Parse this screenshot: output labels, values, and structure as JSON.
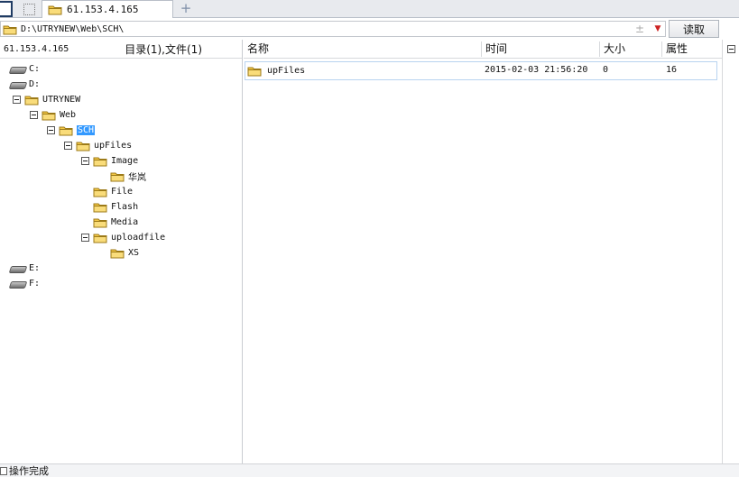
{
  "tabs": [
    {
      "label": "61.153.4.165"
    }
  ],
  "address": {
    "path": "D:\\UTRYNEW\\Web\\SCH\\",
    "up_glyph": "±",
    "drop_glyph": "▼",
    "read_label": "读取"
  },
  "left": {
    "host": "61.153.4.165",
    "count": "目录(1),文件(1)",
    "tree": [
      {
        "label": "C:",
        "type": "drive",
        "level": 0,
        "toggle": false
      },
      {
        "label": "D:",
        "type": "drive",
        "level": 0,
        "toggle": false
      },
      {
        "label": "UTRYNEW",
        "type": "folder",
        "level": 1,
        "toggle": true
      },
      {
        "label": "Web",
        "type": "folder",
        "level": 2,
        "toggle": true
      },
      {
        "label": "SCH",
        "type": "folder",
        "level": 3,
        "toggle": true,
        "selected": true
      },
      {
        "label": "upFiles",
        "type": "folder",
        "level": 4,
        "toggle": true
      },
      {
        "label": "Image",
        "type": "folder",
        "level": 5,
        "toggle": true
      },
      {
        "label": "华岚",
        "type": "folder",
        "level": 6,
        "toggle": false
      },
      {
        "label": "File",
        "type": "folder",
        "level": 5,
        "toggle": false
      },
      {
        "label": "Flash",
        "type": "folder",
        "level": 5,
        "toggle": false
      },
      {
        "label": "Media",
        "type": "folder",
        "level": 5,
        "toggle": false
      },
      {
        "label": "uploadfile",
        "type": "folder",
        "level": 5,
        "toggle": true
      },
      {
        "label": "XS",
        "type": "folder",
        "level": 6,
        "toggle": false
      },
      {
        "label": "E:",
        "type": "drive",
        "level": 0,
        "toggle": false
      },
      {
        "label": "F:",
        "type": "drive",
        "level": 0,
        "toggle": false
      }
    ]
  },
  "columns": {
    "name": "名称",
    "time": "时间",
    "size": "大小",
    "attr": "属性"
  },
  "files": [
    {
      "name": "upFiles",
      "time": "2015-02-03 21:56:20",
      "size": "0",
      "attr": "16"
    }
  ],
  "status": "操作完成",
  "colors": {
    "selection": "#3399ff",
    "folder": "#f3c744"
  }
}
